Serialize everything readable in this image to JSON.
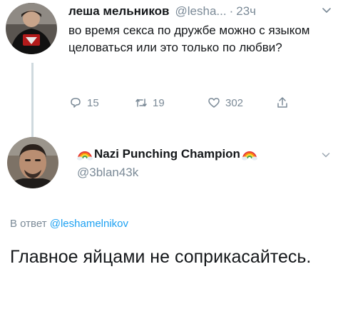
{
  "tweet": {
    "author_name": "леша мельников",
    "author_handle": "@lesha...",
    "separator": "·",
    "time": "23ч",
    "text": "во время секса по дружбе можно с языком целоваться или это только по любви?",
    "actions": {
      "reply_icon": "reply-icon",
      "reply_count": "15",
      "retweet_icon": "retweet-icon",
      "retweet_count": "19",
      "like_icon": "heart-icon",
      "like_count": "302",
      "share_icon": "share-icon"
    }
  },
  "reply": {
    "display_name": "Nazi Punching Champion",
    "name_emoji": "rainbow-icon",
    "handle": "@3blan43k",
    "reply_prefix": "В ответ",
    "reply_mention": "@leshamelnikov",
    "text": "Главное яйцами не соприкасайтесь."
  },
  "colors": {
    "text": "#14171a",
    "secondary": "#7b8a97",
    "link": "#1da1f2",
    "thread_line": "#cfd9de"
  }
}
